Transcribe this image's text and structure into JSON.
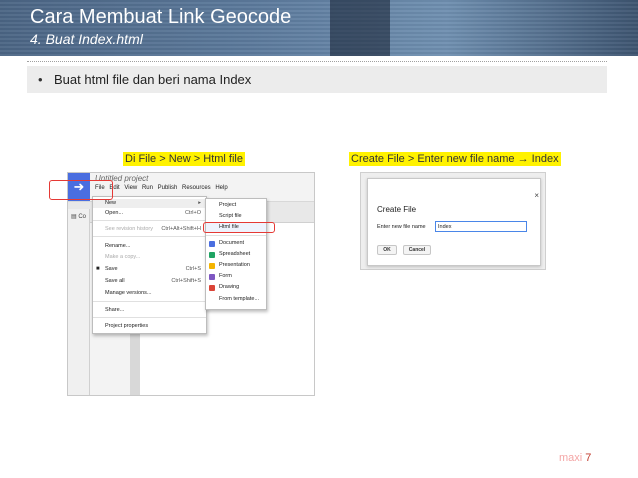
{
  "slide": {
    "title": "Cara Membuat Link Geocode",
    "subtitle": "4. Buat Index.html",
    "bullet": "Buat html file dan beri nama Index",
    "bullet_symbol": "•",
    "caption_left": "Di File > New > Html file",
    "caption_right": "Create File > Enter new file name → Index",
    "brand": "maxi",
    "page_number": "7"
  },
  "editor": {
    "logo_glyph": "➜",
    "project_title": "Untitled project",
    "menubar": [
      "File",
      "Edit",
      "View",
      "Run",
      "Publish",
      "Resources",
      "Help"
    ],
    "side_label": "Co",
    "file_menu": [
      {
        "label": "New",
        "shortcut": "▸",
        "disabled": false,
        "highlight": true
      },
      {
        "label": "Open...",
        "shortcut": "Ctrl+O",
        "disabled": false
      },
      {
        "label": "See revision history",
        "shortcut": "Ctrl+Alt+Shift+H",
        "disabled": true
      },
      {
        "label": "Rename...",
        "shortcut": "",
        "disabled": false
      },
      {
        "label": "Make a copy...",
        "shortcut": "",
        "disabled": true
      },
      {
        "label": "Save",
        "shortcut": "Ctrl+S",
        "disabled": false
      },
      {
        "label": "Save all",
        "shortcut": "Ctrl+Shift+S",
        "disabled": false
      },
      {
        "label": "Manage versions...",
        "shortcut": "",
        "disabled": false
      },
      {
        "label": "Share...",
        "shortcut": "",
        "disabled": false
      },
      {
        "label": "Project properties",
        "shortcut": "",
        "disabled": false
      }
    ],
    "new_submenu": [
      {
        "label": "Project",
        "color": ""
      },
      {
        "label": "Script file",
        "color": ""
      },
      {
        "label": "Html file",
        "color": ""
      },
      {
        "label": "Document",
        "color": "#4a6ee0"
      },
      {
        "label": "Spreadsheet",
        "color": "#1fa463"
      },
      {
        "label": "Presentation",
        "color": "#f4b400"
      },
      {
        "label": "Form",
        "color": "#7e57c2"
      },
      {
        "label": "Drawing",
        "color": "#db4437"
      },
      {
        "label": "From template...",
        "color": ""
      }
    ]
  },
  "dialog": {
    "title": "Create File",
    "close_glyph": "×",
    "field_label": "Enter new file name",
    "field_value": "Index",
    "ok_label": "OK",
    "cancel_label": "Cancel"
  }
}
